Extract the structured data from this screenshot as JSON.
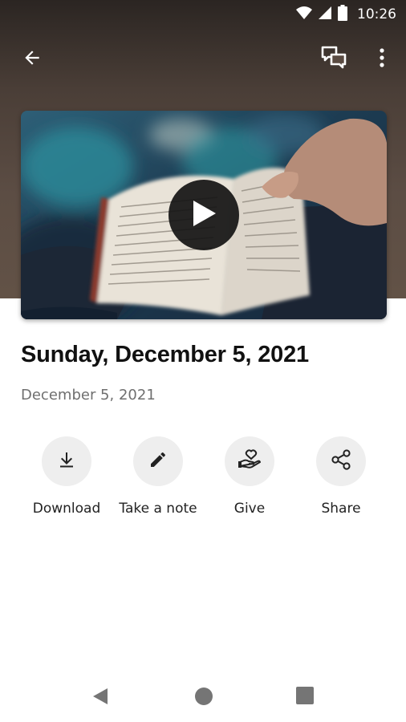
{
  "status_bar": {
    "time": "10:26",
    "icons": [
      "wifi-icon",
      "signal-icon",
      "battery-icon"
    ]
  },
  "app_bar": {
    "back_icon": "arrow-back-icon",
    "chat_icon": "chat-bubbles-icon",
    "more_icon": "more-vert-icon"
  },
  "video": {
    "thumbnail": "open-bible-photo",
    "play_icon": "play-icon"
  },
  "sermon": {
    "title": "Sunday, December 5, 2021",
    "date": "December 5, 2021"
  },
  "actions": [
    {
      "label": "Download",
      "icon": "download-icon"
    },
    {
      "label": "Take a note",
      "icon": "pencil-icon"
    },
    {
      "label": "Give",
      "icon": "give-heart-hand-icon"
    },
    {
      "label": "Share",
      "icon": "share-icon"
    }
  ],
  "nav_bar": {
    "icons": [
      "nav-back-icon",
      "nav-home-icon",
      "nav-recents-icon"
    ]
  },
  "colors": {
    "hero_background": "#5c4d44",
    "action_circle": "#eeeeee",
    "title_text": "#111111",
    "subtitle_text": "#6f6f6f",
    "play_button": "#141414"
  }
}
